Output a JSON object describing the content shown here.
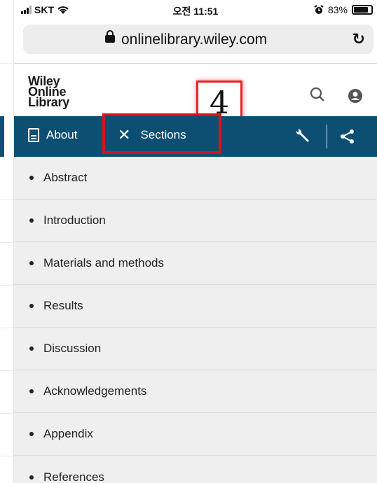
{
  "status_bar": {
    "carrier": "SKT",
    "time": "오전 11:51",
    "battery": "83%"
  },
  "browser": {
    "url": "onlinelibrary.wiley.com"
  },
  "site": {
    "logo_lines": [
      "Wiley",
      "Online",
      "Library"
    ]
  },
  "annotation": {
    "number": "4"
  },
  "navbar": {
    "about_label": "About",
    "sections_label": "Sections"
  },
  "sections": [
    {
      "label": "Abstract"
    },
    {
      "label": "Introduction"
    },
    {
      "label": "Materials and methods"
    },
    {
      "label": "Results"
    },
    {
      "label": "Discussion"
    },
    {
      "label": "Acknowledgements"
    },
    {
      "label": "Appendix"
    },
    {
      "label": "References"
    }
  ],
  "colors": {
    "navbar": "#0d4f73",
    "list_bg": "#efefef",
    "annotation_red": "#d4141b"
  },
  "icons": [
    "signal-icon",
    "wifi-icon",
    "alarm-icon",
    "battery-icon",
    "lock-icon",
    "reload-icon",
    "search-icon",
    "user-icon",
    "document-icon",
    "close-icon",
    "wrench-icon",
    "share-icon"
  ]
}
